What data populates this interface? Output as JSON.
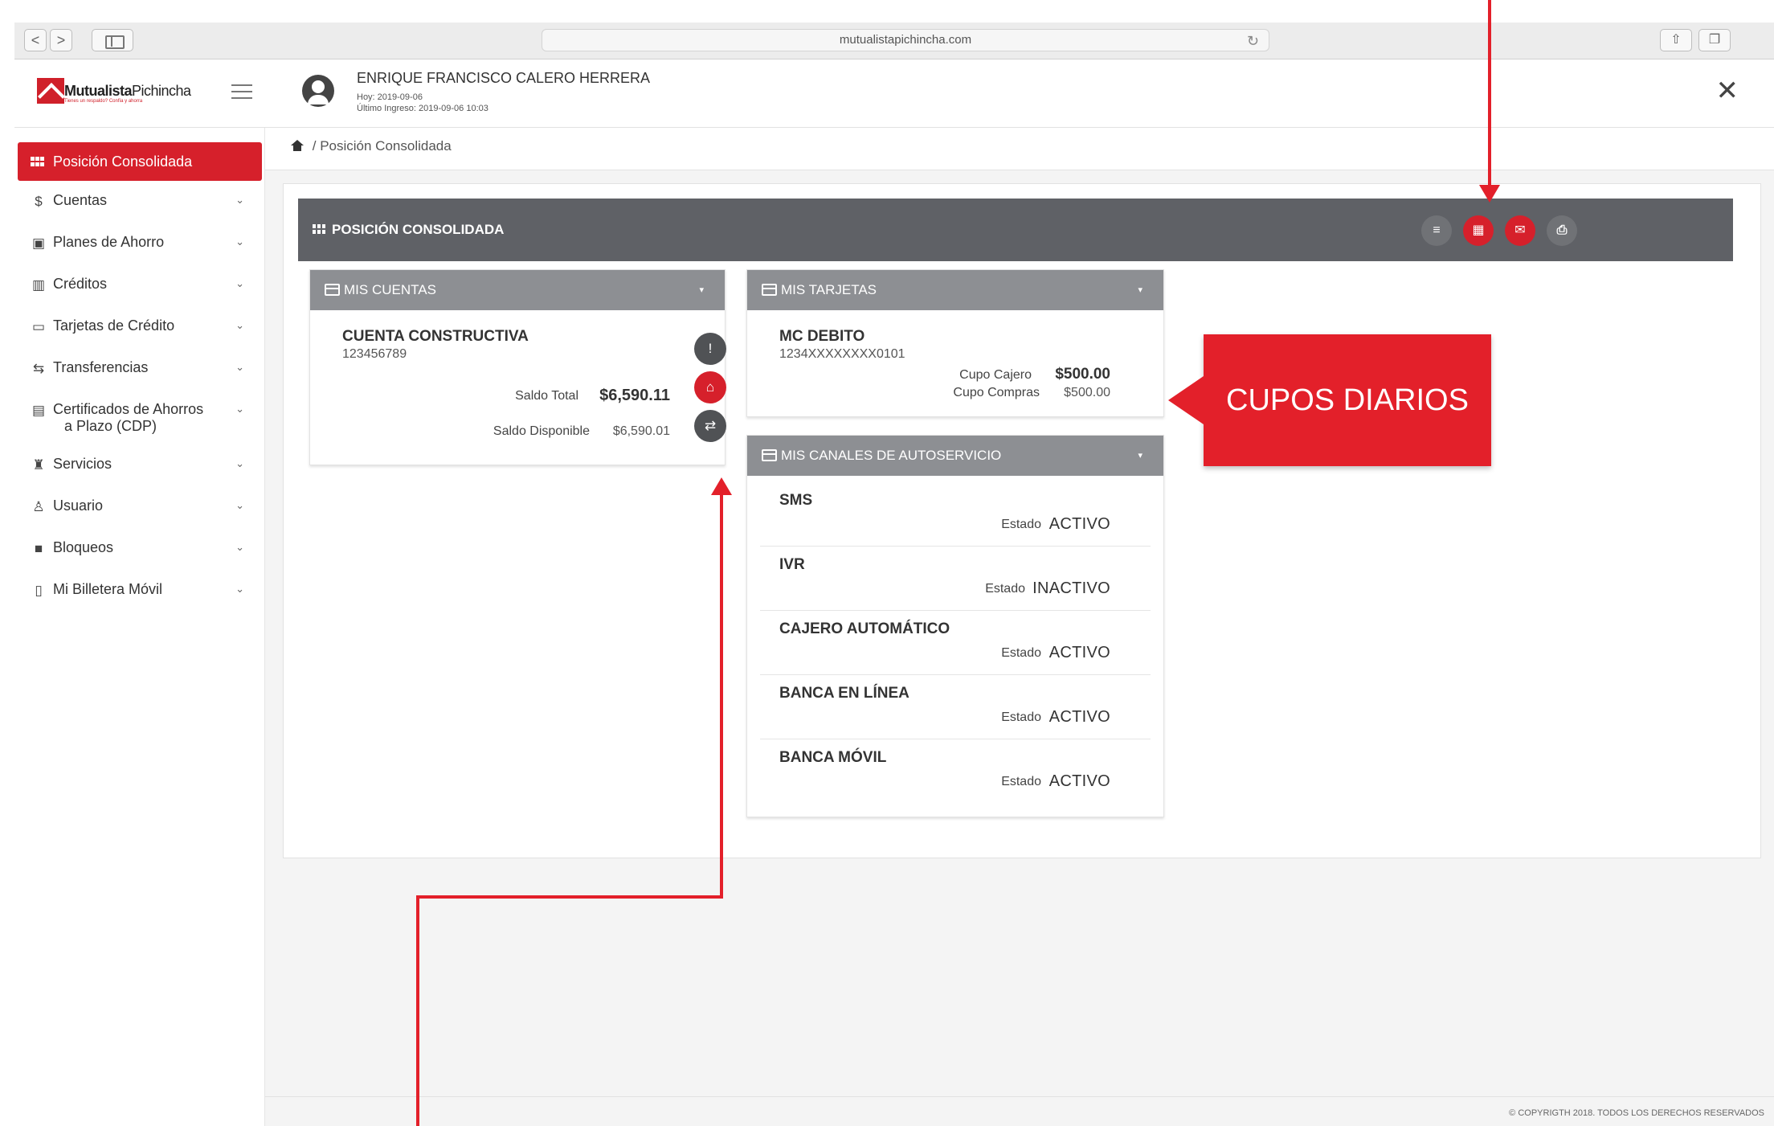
{
  "browser": {
    "url": "mutualistapichincha.com",
    "back_glyph": "<",
    "fwd_glyph": ">",
    "reload_glyph": "↻",
    "share_glyph": "⇧",
    "tabs_glyph": "❐"
  },
  "brand": {
    "name_bold": "Mutualista",
    "name_light": "Pichincha",
    "tagline": "Tienes un respaldo? Confía y ahorra",
    "accent": "#d6202b"
  },
  "user": {
    "name": "ENRIQUE FRANCISCO CALERO HERRERA",
    "today": "Hoy: 2019-09-06",
    "last_login": "Último Ingreso: 2019-09-06 10:03",
    "close_glyph": "✕"
  },
  "sidebar": {
    "active": "Posición Consolidada",
    "items": [
      {
        "label": "Cuentas",
        "icon": "$"
      },
      {
        "label": "Planes de Ahorro",
        "icon": "▣"
      },
      {
        "label": "Créditos",
        "icon": "▥"
      },
      {
        "label": "Tarjetas de Crédito",
        "icon": "▭"
      },
      {
        "label": "Transferencias",
        "icon": "⇆"
      },
      {
        "label": "Certificados de Ahorros",
        "label2": "a Plazo (CDP)",
        "icon": "▤"
      },
      {
        "label": "Servicios",
        "icon": "♜"
      },
      {
        "label": "Usuario",
        "icon": "♙"
      },
      {
        "label": "Bloqueos",
        "icon": "■"
      },
      {
        "label": "Mi Billetera Móvil",
        "icon": "▯"
      }
    ],
    "chevron": "⌄"
  },
  "breadcrumb": {
    "separator": "/",
    "current": "Posición Consolidada"
  },
  "panel": {
    "title": "POSICIÓN CONSOLIDADA",
    "btn_list": "≡",
    "btn_grid": "▦",
    "btn_mail": "✉",
    "btn_print": "⎙"
  },
  "cuentas": {
    "title": "MIS CUENTAS",
    "carat": "▾",
    "name": "CUENTA CONSTRUCTIVA",
    "number": "123456789",
    "saldo_total_label": "Saldo Total",
    "saldo_total": "$6,590.11",
    "saldo_disp_label": "Saldo Disponible",
    "saldo_disp": "$6,590.01",
    "btn_info": "!",
    "btn_bank": "⌂",
    "btn_transfer": "⇄"
  },
  "tarjetas": {
    "title": "MIS TARJETAS",
    "carat": "▾",
    "name": "MC DEBITO",
    "number": "1234XXXXXXXX0101",
    "cupo_cajero_label": "Cupo Cajero",
    "cupo_cajero": "$500.00",
    "cupo_compras_label": "Cupo Compras",
    "cupo_compras": "$500.00"
  },
  "canales": {
    "title": "MIS CANALES DE AUTOSERVICIO",
    "carat": "▾",
    "estado_label": "Estado",
    "items": [
      {
        "name": "SMS",
        "estado": "ACTIVO"
      },
      {
        "name": "IVR",
        "estado": "INACTIVO"
      },
      {
        "name": "CAJERO AUTOMÁTICO",
        "estado": "ACTIVO"
      },
      {
        "name": "BANCA EN LÍNEA",
        "estado": "ACTIVO"
      },
      {
        "name": "BANCA MÓVIL",
        "estado": "ACTIVO"
      }
    ]
  },
  "annotation": {
    "label": "CUPOS DIARIOS",
    "color": "#e3202a"
  },
  "footer": {
    "text": "© COPYRIGTH 2018. TODOS LOS DERECHOS RESERVADOS"
  }
}
